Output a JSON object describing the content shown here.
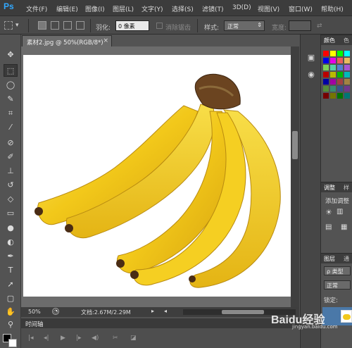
{
  "app": {
    "logo": "Ps"
  },
  "menu": [
    "文件(F)",
    "编辑(E)",
    "图像(I)",
    "图层(L)",
    "文字(Y)",
    "选择(S)",
    "滤镜(T)",
    "3D(D)",
    "视图(V)",
    "窗口(W)",
    "帮助(H)"
  ],
  "window_controls": {
    "minimize": "–",
    "restore": "□",
    "close": "✕"
  },
  "options": {
    "feather_label": "羽化:",
    "feather_value": "0 像素",
    "antialias_label": "消除锯齿",
    "style_label": "样式:",
    "style_value": "正常",
    "width_label": "宽度:"
  },
  "tools": [
    "move-tool",
    "marquee-tool",
    "lasso-tool",
    "quick-select-tool",
    "crop-tool",
    "eyedropper-tool",
    "healing-brush-tool",
    "brush-tool",
    "clone-stamp-tool",
    "history-brush-tool",
    "eraser-tool",
    "gradient-tool",
    "blur-tool",
    "dodge-tool",
    "pen-tool",
    "type-tool",
    "path-select-tool",
    "shape-tool",
    "hand-tool",
    "zoom-tool"
  ],
  "document": {
    "tab_title": "素材2.jpg @ 50%(RGB/8*)",
    "zoom": "50%",
    "doc_size": "文档:2.67M/2.29M"
  },
  "timeline": {
    "tab": "时间轴"
  },
  "panels": {
    "color_tabs": [
      "颜色",
      "色"
    ],
    "adjust_tabs": [
      "调整",
      "样"
    ],
    "adjust_add": "添加调整",
    "layer_tabs": [
      "图层",
      "通"
    ],
    "layer_filter": "ρ 类型",
    "blend_mode": "正常",
    "lock_label": "锁定:"
  },
  "watermark": {
    "text": "Baidu经验",
    "sub": "jingyan.baidu.com"
  },
  "colors": {
    "menubar": "#3c3c3c",
    "panel": "#535353",
    "accent": "#31a8ff",
    "banana": "#f2c81a",
    "stem": "#5a3a1c"
  }
}
